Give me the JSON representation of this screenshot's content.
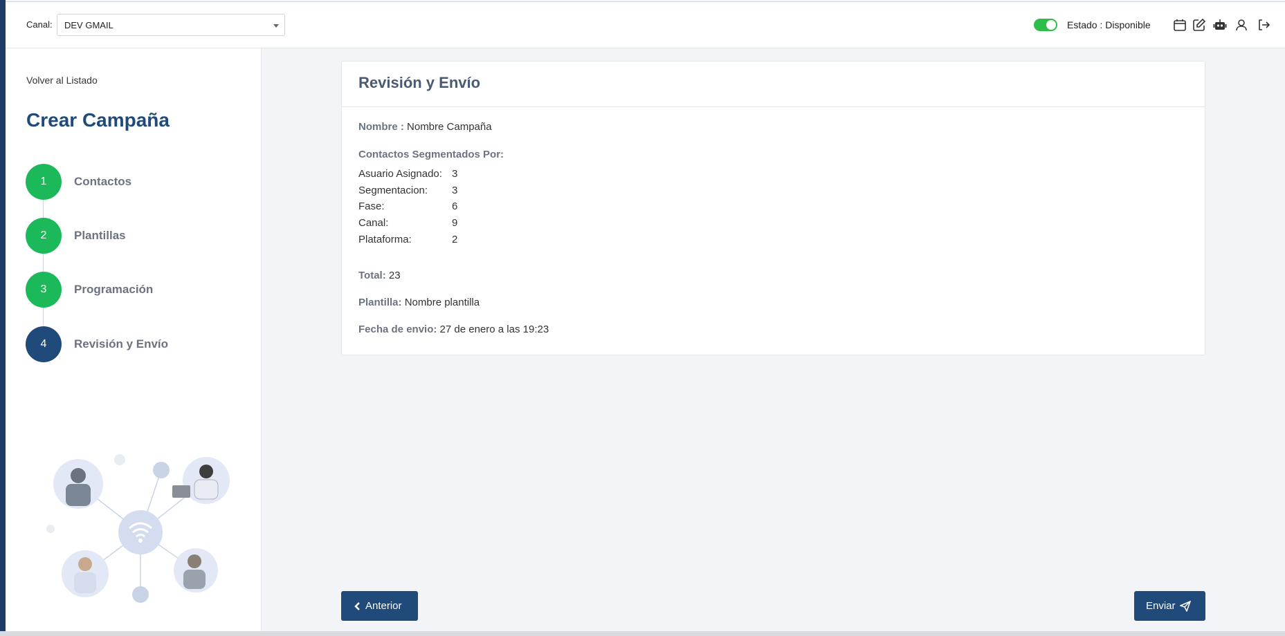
{
  "topbar": {
    "canal_label": "Canal:",
    "canal_value": "DEV GMAIL",
    "estado": "Estado : Disponible",
    "icons": [
      "calendar-icon",
      "edit-icon",
      "robot-icon",
      "user-icon",
      "logout-icon"
    ]
  },
  "sidebar": {
    "back_link": "Volver al Listado",
    "title": "Crear Campaña",
    "steps": [
      {
        "number": "1",
        "label": "Contactos",
        "state": "done"
      },
      {
        "number": "2",
        "label": "Plantillas",
        "state": "done"
      },
      {
        "number": "3",
        "label": "Programación",
        "state": "done"
      },
      {
        "number": "4",
        "label": "Revisión y Envío",
        "state": "active"
      }
    ]
  },
  "card": {
    "title": "Revisión y Envío",
    "nombre_label": "Nombre :",
    "nombre_value": "Nombre Campaña",
    "segment_heading": "Contactos Segmentados Por:",
    "segments": [
      {
        "key": "Asuario Asignado:",
        "value": "3"
      },
      {
        "key": "Segmentacion:",
        "value": "3"
      },
      {
        "key": "Fase:",
        "value": "6"
      },
      {
        "key": "Canal:",
        "value": "9"
      },
      {
        "key": "Plataforma:",
        "value": "2"
      }
    ],
    "total_label": "Total:",
    "total_value": "23",
    "plantilla_label": "Plantilla:",
    "plantilla_value": "Nombre plantilla",
    "fecha_label": "Fecha de envio:",
    "fecha_value": "27 de enero a las 19:23"
  },
  "buttons": {
    "prev": "Anterior",
    "next": "Enviar"
  },
  "colors": {
    "primary": "#1f4a7a",
    "success": "#1cb95a",
    "toggle": "#2ebd4a"
  }
}
